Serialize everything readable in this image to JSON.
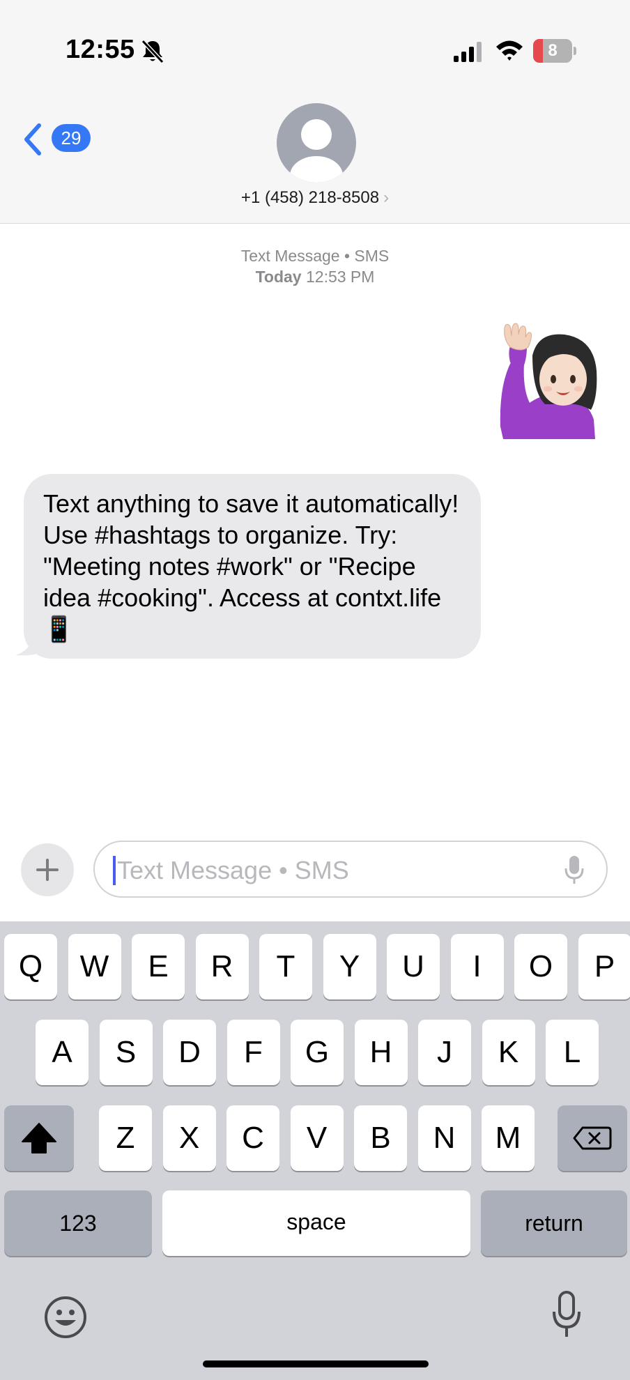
{
  "status_bar": {
    "time": "12:55",
    "battery_level": "8",
    "icons": [
      "bell-slash-icon",
      "cellular-signal-icon",
      "wifi-icon",
      "battery-icon"
    ]
  },
  "header": {
    "back_badge_count": "29",
    "contact_number": "+1 (458) 218-8508",
    "contact_chevron": "›"
  },
  "conversation": {
    "service_label": "Text Message • SMS",
    "date_label": "Today",
    "time_label": "12:53 PM",
    "messages": [
      {
        "direction": "outgoing",
        "type": "emoji",
        "emoji_name": "woman-raising-hand-emoji"
      },
      {
        "direction": "incoming",
        "type": "text",
        "text": "Text anything to save it automatically! Use #hashtags to organize. Try: \"Meeting notes #work\" or \"Recipe idea #cooking\". Access at contxt.life 📱"
      }
    ]
  },
  "compose": {
    "placeholder": "Text Message • SMS",
    "value": ""
  },
  "keyboard": {
    "row1": [
      "Q",
      "W",
      "E",
      "R",
      "T",
      "Y",
      "U",
      "I",
      "O",
      "P"
    ],
    "row2": [
      "A",
      "S",
      "D",
      "F",
      "G",
      "H",
      "J",
      "K",
      "L"
    ],
    "row3": [
      "Z",
      "X",
      "C",
      "V",
      "B",
      "N",
      "M"
    ],
    "numbers_label": "123",
    "space_label": "space",
    "return_label": "return"
  },
  "colors": {
    "accent": "#3478f6",
    "incoming_bubble": "#e9e9eb",
    "battery_low": "#e5484d",
    "keyboard_bg": "#d1d3d9"
  }
}
